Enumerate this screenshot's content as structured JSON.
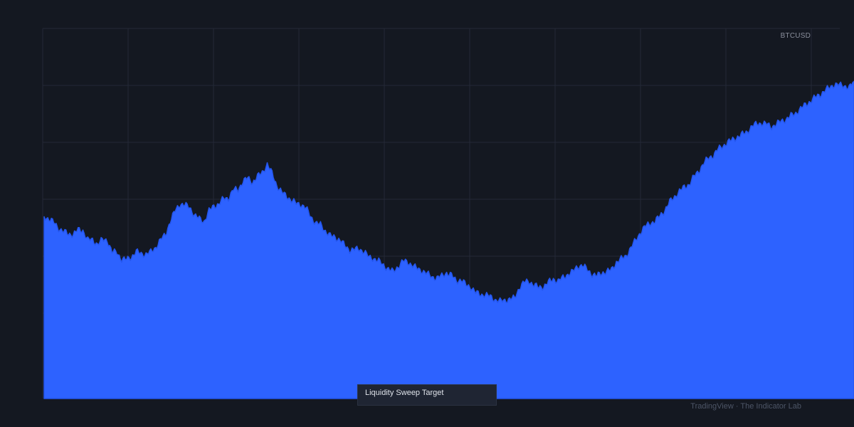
{
  "chart_data": {
    "type": "area",
    "symbol": "BTCUSD",
    "annotation": "Liquidity Sweep Target",
    "watermark": "TradingView · The Indicator Lab",
    "ylim": [
      0,
      700
    ],
    "grid": true,
    "colors": {
      "background": "#141821",
      "grid": "#242936",
      "area_fill": "#2d62ff",
      "area_line": "#2456ef"
    },
    "series": [
      {
        "values": [
          344,
          340,
          333,
          322,
          316,
          311,
          311,
          319,
          318,
          300,
          300,
          292,
          300,
          300,
          277,
          277,
          263,
          263,
          268,
          278,
          274,
          273,
          277,
          286,
          300,
          310,
          335,
          355,
          368,
          366,
          362,
          347,
          340,
          335,
          355,
          364,
          368,
          378,
          379,
          395,
          395,
          411,
          417,
          409,
          420,
          428,
          443,
          426,
          403,
          390,
          383,
          375,
          369,
          367,
          360,
          344,
          332,
          329,
          317,
          308,
          305,
          300,
          289,
          281,
          282,
          283,
          278,
          267,
          265,
          260,
          252,
          245,
          240,
          250,
          260,
          258,
          252,
          245,
          242,
          236,
          230,
          228,
          232,
          238,
          233,
          223,
          224,
          215,
          211,
          200,
          197,
          196,
          193,
          187,
          184,
          186,
          188,
          190,
          210,
          220,
          222,
          215,
          210,
          212,
          220,
          226,
          222,
          229,
          235,
          240,
          250,
          252,
          244,
          235,
          232,
          238,
          240,
          244,
          258,
          264,
          270,
          285,
          300,
          315,
          326,
          332,
          335,
          346,
          356,
          372,
          382,
          392,
          400,
          405,
          420,
          430,
          445,
          455,
          460,
          472,
          478,
          485,
          490,
          495,
          500,
          505,
          515,
          520,
          521,
          519,
          514,
          519,
          525,
          528,
          535,
          540,
          548,
          556,
          562,
          570,
          575,
          582,
          589,
          594,
          593,
          592,
          588,
          600
        ]
      }
    ]
  }
}
